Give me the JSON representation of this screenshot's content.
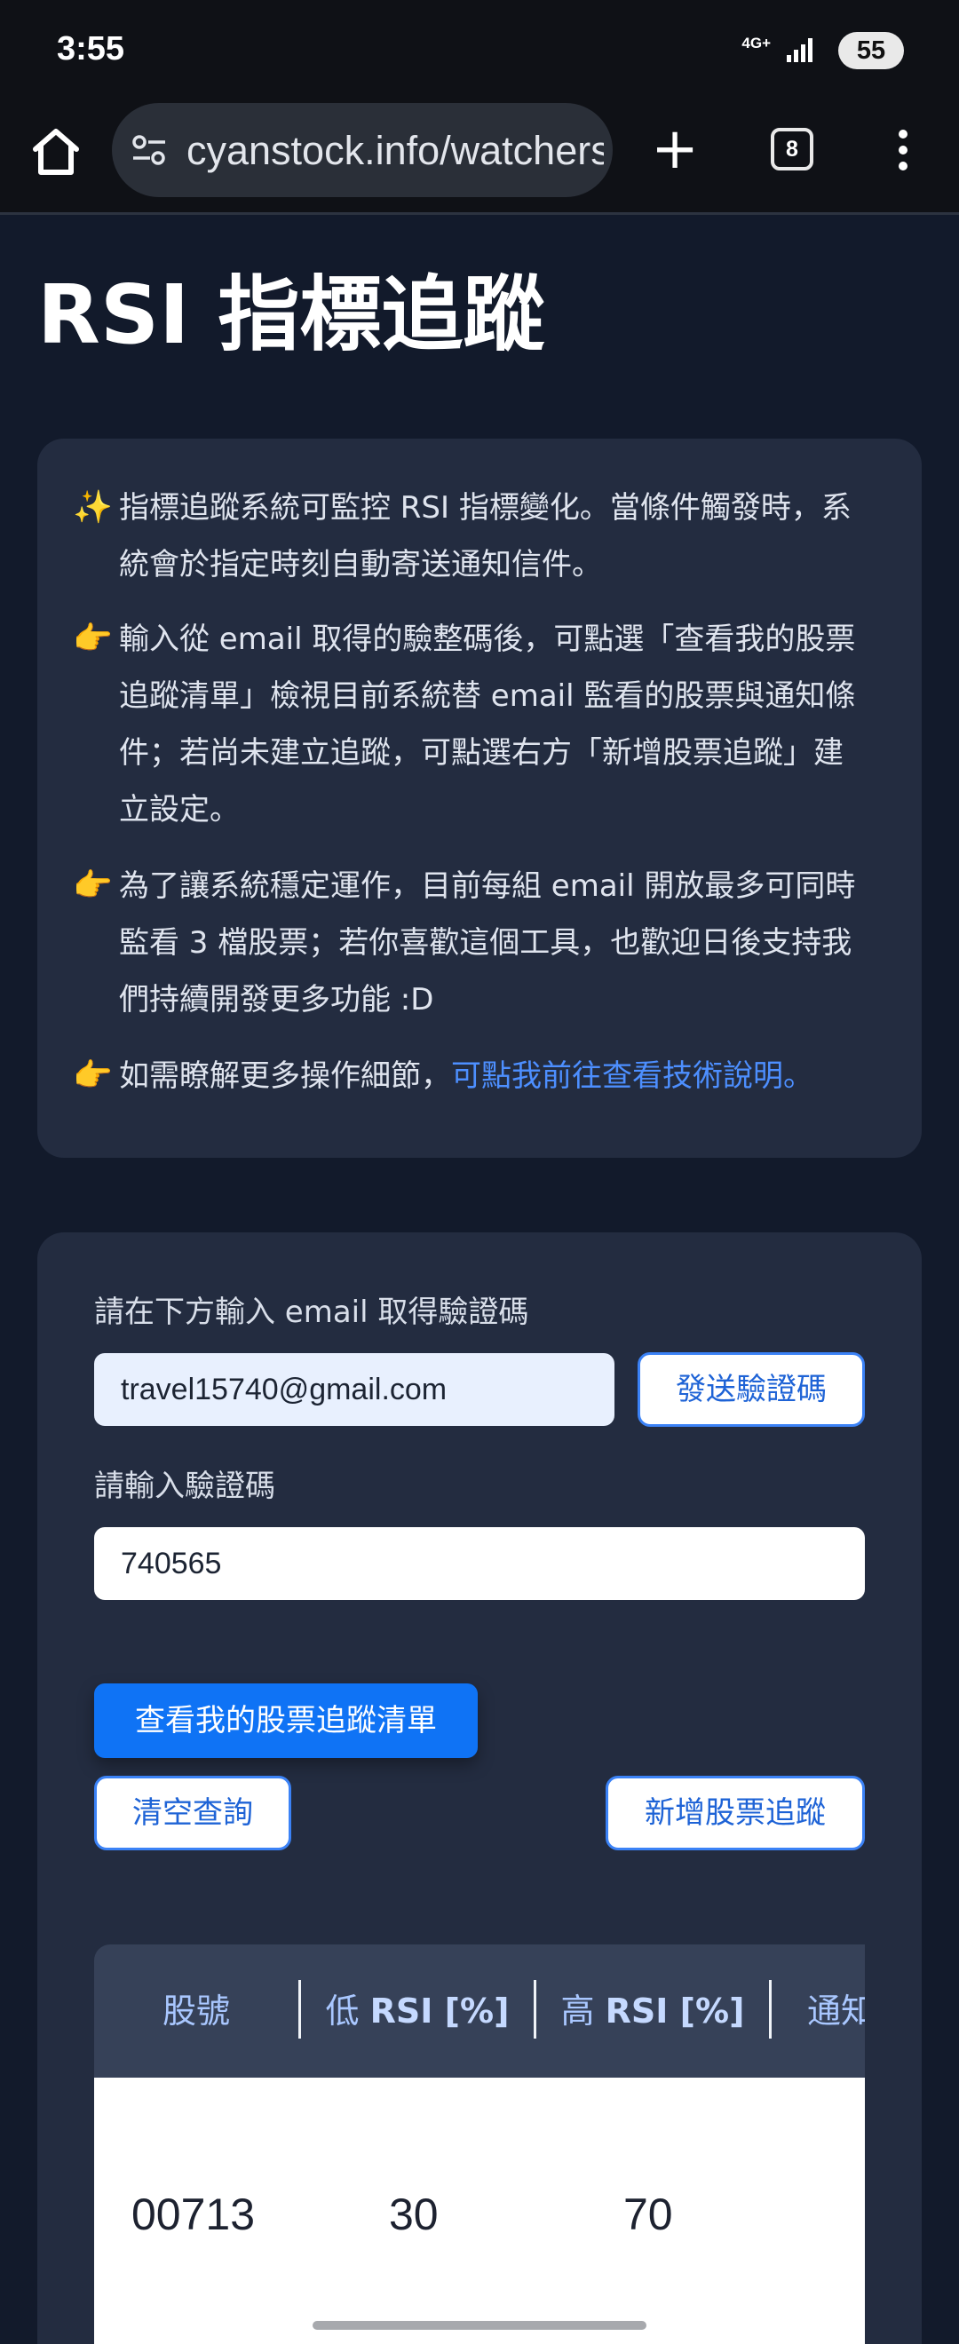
{
  "status_bar": {
    "time": "3:55",
    "network": "4G+",
    "battery": "55"
  },
  "browser": {
    "url": "cyanstock.info/watchers",
    "tab_count": "8"
  },
  "page": {
    "title": "RSI 指標追蹤",
    "info_items": [
      {
        "icon": "sparkles-icon",
        "glyph": "✨",
        "lines": [
          "指標追蹤系統可監控 RSI 指標變化。當條件觸發時，系",
          "統會於指定時刻自動寄送通知信件。"
        ]
      },
      {
        "icon": "pointing-hand-icon",
        "glyph": "👉",
        "lines": [
          "輸入從 email 取得的驗整碼後，可點選「查看我的股票",
          "追蹤清單」檢視目前系統替 email 監看的股票與通知條",
          "件；若尚未建立追蹤，可點選右方「新增股票追蹤」建",
          "立設定。"
        ]
      },
      {
        "icon": "pointing-hand-icon",
        "glyph": "👉",
        "lines": [
          "為了讓系統穩定運作，目前每組 email 開放最多可同時",
          "監看 3 檔股票；若你喜歡這個工具，也歡迎日後支持我",
          "們持續開發更多功能 :D"
        ]
      },
      {
        "icon": "pointing-hand-icon",
        "glyph": "👉",
        "text": "如需瞭解更多操作細節，",
        "link": "可點我前往查看技術說明。"
      }
    ]
  },
  "form": {
    "email_label": "請在下方輸入 email 取得驗證碼",
    "email_value": "travel15740@gmail.com",
    "send_code_button": "發送驗證碼",
    "code_label": "請輸入驗證碼",
    "code_value": "740565",
    "view_list_button": "查看我的股票追蹤清單",
    "clear_button": "清空查詢",
    "add_button": "新增股票追蹤"
  },
  "table": {
    "headers": [
      {
        "prefix": "股號",
        "bold": ""
      },
      {
        "prefix": "低 ",
        "bold": "RSI [%]"
      },
      {
        "prefix": "高 ",
        "bold": "RSI [%]"
      },
      {
        "prefix": "通知",
        "bold": ""
      }
    ],
    "rows": [
      {
        "stock_id": "00713",
        "low_rsi": "30",
        "high_rsi": "70"
      }
    ]
  }
}
